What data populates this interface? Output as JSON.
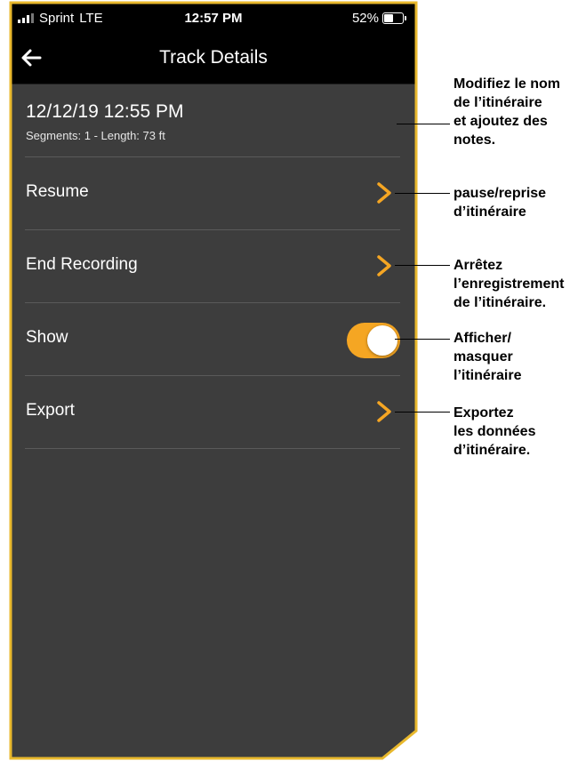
{
  "status_bar": {
    "carrier": "Sprint",
    "network": "LTE",
    "time": "12:57 PM",
    "battery": "52%"
  },
  "nav": {
    "title": "Track Details",
    "back_icon": "arrow-left-icon"
  },
  "track": {
    "name": "12/12/19 12:55 PM",
    "meta": "Segments: 1  -  Length: 73 ft"
  },
  "rows": [
    {
      "label": "Resume",
      "control": "chevron"
    },
    {
      "label": "End Recording",
      "control": "chevron"
    },
    {
      "label": "Show",
      "control": "toggle",
      "toggle_on": true
    },
    {
      "label": "Export",
      "control": "chevron"
    }
  ],
  "callouts": {
    "edit": [
      "Modifiez le nom",
      "de l’itinéraire",
      "et ajoutez des",
      "notes."
    ],
    "resume": [
      "pause/reprise",
      "d’itinéraire"
    ],
    "end": [
      "Arrêtez",
      "l’enregistrement",
      "de l’itinéraire."
    ],
    "show": [
      "Afficher/",
      "masquer",
      "l’itinéraire"
    ],
    "export": [
      "Exportez",
      "les données",
      "d’itinéraire."
    ]
  },
  "colors": {
    "accent": "#f5a623",
    "frame": "#e8b82d",
    "screen_bg": "#3d3d3d",
    "header_bg": "#000000"
  }
}
